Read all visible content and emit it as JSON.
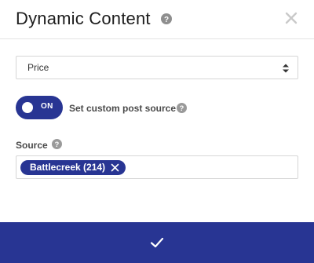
{
  "dialog": {
    "title": "Dynamic Content",
    "icons": {
      "help": "question-circle-icon",
      "close": "close-icon"
    }
  },
  "field": {
    "select_value": "Price"
  },
  "custom_source": {
    "toggle_state": "ON",
    "label": "Set custom post source",
    "accent_color": "#283593"
  },
  "source": {
    "label": "Source",
    "tags": [
      {
        "label": "Battlecreek (214)"
      }
    ]
  },
  "footer": {
    "confirm_icon": "checkmark-icon",
    "background_color": "#283593"
  }
}
